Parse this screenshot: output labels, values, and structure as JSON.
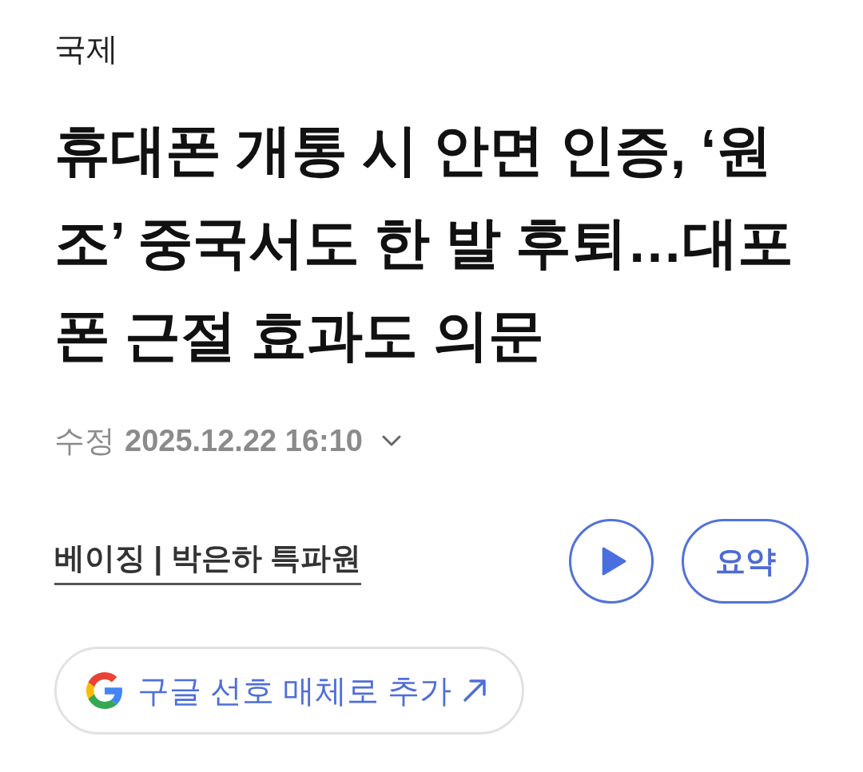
{
  "category": "국제",
  "headline": "휴대폰 개통 시 안면 인증, ‘원조’ 중국서도 한 발 후퇴…대포폰 근절 효과도 의문",
  "meta": {
    "label": "수정",
    "datetime": "2025.12.22 16:10",
    "expanded": false
  },
  "byline": "베이징 | 박은하 특파원",
  "actions": [
    {
      "kind": "play"
    },
    {
      "kind": "summary",
      "label": "요약"
    }
  ],
  "google_button": {
    "label": "구글 선호 매체로 추가"
  }
}
